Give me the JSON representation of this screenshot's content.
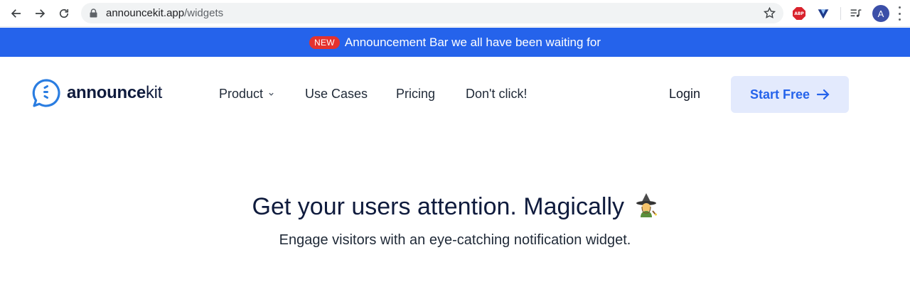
{
  "browser": {
    "url_host": "announcekit.app",
    "url_path": "/widgets",
    "abp_label": "ABP",
    "avatar_letter": "A"
  },
  "announcement": {
    "badge": "NEW",
    "text": "Announcement Bar we all have been waiting for",
    "background": "#2563eb"
  },
  "header": {
    "logo_bold": "announce",
    "logo_light": "kit",
    "nav": [
      "Product",
      "Use Cases",
      "Pricing",
      "Don't click!"
    ],
    "login": "Login",
    "cta": "Start Free",
    "cta_background": "#e3eafd",
    "accent": "#2563eb"
  },
  "hero": {
    "title": "Get your users attention. Magically",
    "emoji": "wizard-icon",
    "subtitle": "Engage visitors with an eye-catching notification widget."
  }
}
